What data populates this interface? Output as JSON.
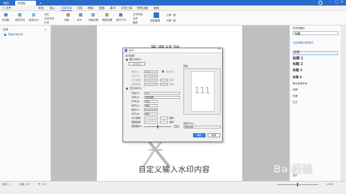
{
  "titlebar": {
    "home_tab": "首页",
    "doc_tab": "文档标题.docx",
    "plus": "+"
  },
  "menubar": {
    "items": [
      "三 文件",
      "开始",
      "插入",
      "页面布局",
      "引用",
      "审阅",
      "视图",
      "章节",
      "开发工具",
      "特色功能",
      "查找"
    ]
  },
  "ribbon": {
    "groups": [
      "页边距",
      "纸张方向",
      "纸张大小",
      "分栏",
      "文字方向",
      "行号",
      "背景",
      "水印",
      "页面边框",
      "稿纸设置",
      "首字下沉",
      "文字环绕",
      "对齐",
      "旋转",
      "选择窗格",
      "上移一层",
      "下移一层"
    ]
  },
  "left_pane": {
    "title": "目录",
    "item": "智能识别目录"
  },
  "right_pane": {
    "header": "样式和格式",
    "current_style": "标题",
    "section_label": "请选择要应用的格式",
    "styles": [
      "标题",
      "标题 1",
      "标题 2",
      "标题 3",
      "标题 4",
      "默认段落字体",
      "页脚",
      "页眉",
      "正文",
      "显示"
    ]
  },
  "document": {
    "top_text": "百度经验",
    "bottom_text": "自定义输入水印内容",
    "watermark_brand": "Bai经验"
  },
  "dialog": {
    "title": "水印",
    "section": "水印设置",
    "picture_watermark": "图片水印(I)",
    "select_picture": "选择图片",
    "scale_label": "缩放(L):",
    "scale_value": "自动",
    "washout_label": "冲蚀(W)",
    "align_label": "对齐(A):",
    "h_pos_label": "水平距离",
    "v_pos_label": "垂直距离",
    "unit": "厘米",
    "text_watermark": "文字水印(X)",
    "content_label": "内容(T):",
    "content_value": "111",
    "font_label": "字体(F):",
    "font_value": "微软雅黑",
    "size_label": "字号(S):",
    "size_value": "自动",
    "style_label": "版式(L):",
    "style_value": "倾斜",
    "color_label": "颜色(C):",
    "align2_label": "对齐(A):",
    "align2_value": "居中",
    "transparency_label": "透明度(E):",
    "transparency_value": "50",
    "preview_label": "预览",
    "preview_text": "111",
    "apply_label": "应用于(Y):",
    "apply_value": "整篇文档",
    "ok": "确定",
    "cancel": "取消"
  },
  "status": {
    "page": "页码: 1",
    "pages": "页面: 1/1",
    "section": "节: 1/1",
    "zoom": "100%"
  },
  "colors": {
    "accent": "#2a6cc9",
    "dialog_primary": "#3a7ee0",
    "watermark_gray": "#9a9a9a"
  }
}
